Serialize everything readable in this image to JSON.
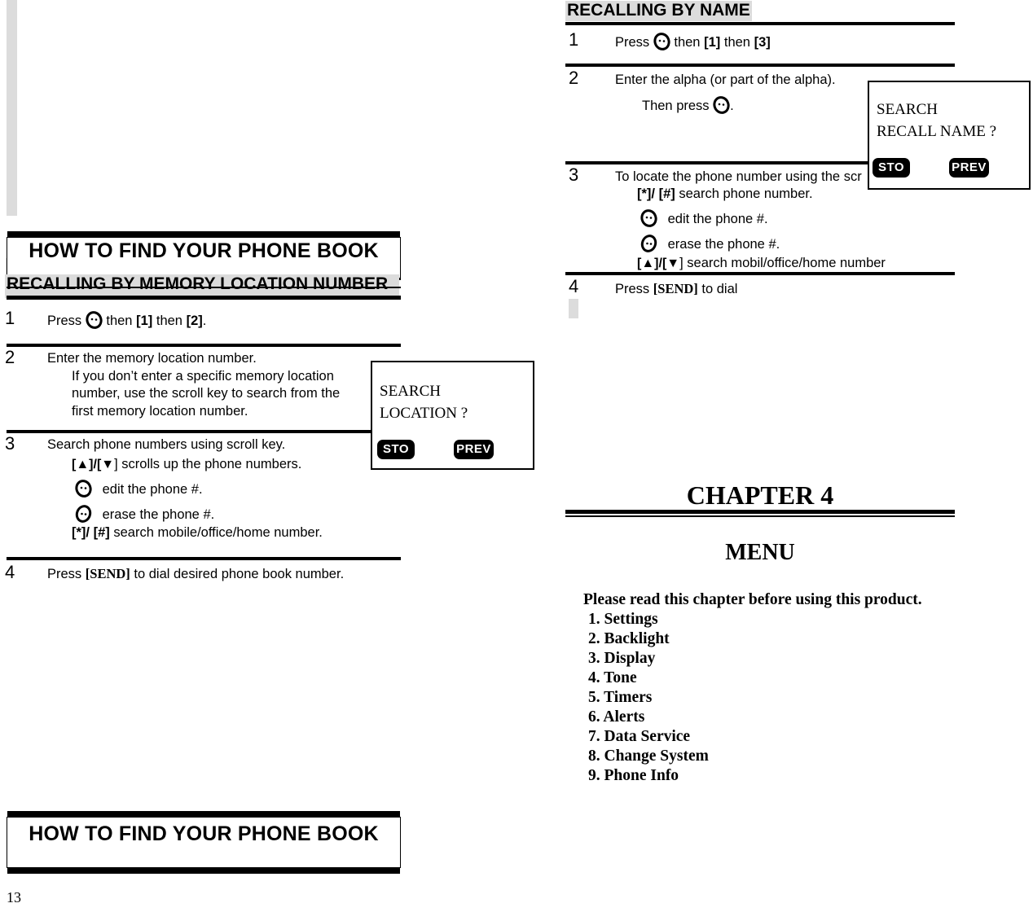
{
  "page": {
    "number": "13",
    "left_margin_bar": "decorative-gray-bar"
  },
  "left_column": {
    "header_top": {
      "title": "HOW TO FIND YOUR PHONE BOOK"
    },
    "section_title": "RECALLING BY MEMORY LOCATION NUMBER",
    "steps": [
      {
        "number": "1",
        "line_prefix": "Press",
        "icon": "key-icon",
        "line_suffix_a": "then",
        "key_a": "[1]",
        "line_suffix_b": "then",
        "key_b": "[2]",
        "line_end": "."
      },
      {
        "number": "2",
        "main": "Enter the memory location number.",
        "note": "If you don’t enter a specific memory location number, use the scroll key to search from the first memory location number."
      },
      {
        "number": "3",
        "main": "Search phone numbers using scroll key.",
        "sub_scroll": "] scrolls up the phone numbers.",
        "sub_edit": "edit the phone #.",
        "sub_erase": "erase the phone #.",
        "sub_star": "search mobile/office/home number."
      },
      {
        "number": "4",
        "pre": "Press",
        "key": "[SEND]",
        "post": "to dial desired phone book number."
      }
    ],
    "lcd": {
      "line1": "SEARCH",
      "line2": "LOCATION ?",
      "softkey_left": "STO",
      "softkey_right": "PREV"
    },
    "header_bottom": {
      "title": "HOW TO FIND YOUR PHONE BOOK"
    }
  },
  "right_column": {
    "section_title": "RECALLING BY NAME",
    "steps": [
      {
        "number": "1",
        "line_prefix": "Press",
        "icon": "key-icon",
        "line_suffix_a": "then",
        "key_a": "[1]",
        "line_suffix_b": "then",
        "key_b": "[3]"
      },
      {
        "number": "2",
        "main": "Enter the alpha (or part of the alpha).",
        "note_pre": "Then press",
        "note_post": "."
      },
      {
        "number": "3",
        "main": "To locate the phone number using the scr",
        "sub_star": "search phone number.",
        "sub_edit": "edit the phone #.",
        "sub_erase": "erase the phone #.",
        "sub_scroll": "] search mobil/office/home number"
      },
      {
        "number": "4",
        "pre": "Press",
        "key": "[SEND]",
        "post": "to dial"
      }
    ],
    "lcd": {
      "line1": "SEARCH",
      "line2": "RECALL NAME ?",
      "softkey_left": "STO",
      "softkey_right": "PREV"
    },
    "chapter": {
      "number": "CHAPTER 4",
      "title": "MENU",
      "intro": "Please read this chapter before using this product.",
      "items": [
        "1. Settings",
        "2. Backlight",
        "3. Display",
        "4. Tone",
        "5. Timers",
        "6. Alerts",
        "7. Data Service",
        "8. Change System",
        "9. Phone Info"
      ]
    }
  },
  "keys": {
    "up": "[▲",
    "slash_down": "]/[▼",
    "star": "[*",
    "slash_hash": "]/ [#]"
  }
}
